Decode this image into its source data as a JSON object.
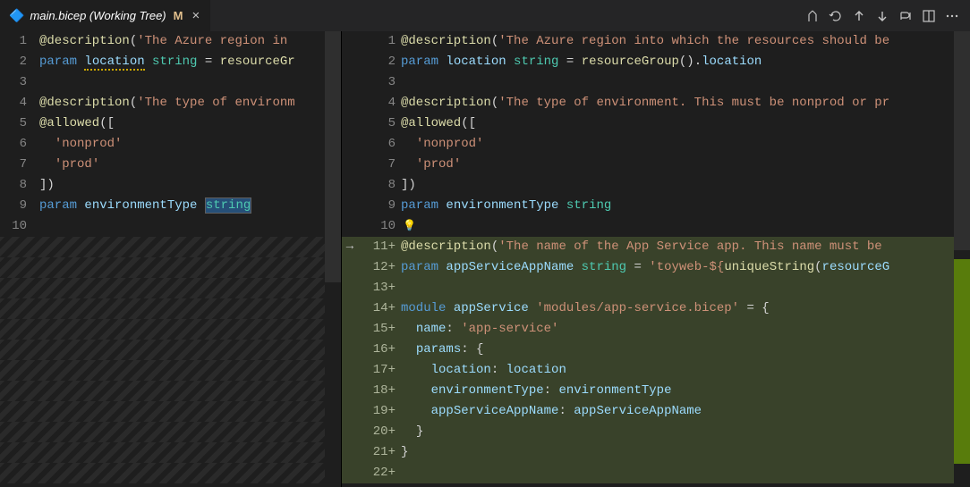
{
  "tab": {
    "icon": "🔷",
    "title": "main.bicep (Working Tree)",
    "modified_badge": "M",
    "close": "×"
  },
  "left": {
    "lines": [
      {
        "num": "1",
        "tokens": [
          [
            "decor",
            "@description"
          ],
          [
            "punc",
            "("
          ],
          [
            "str",
            "'The Azure region in"
          ]
        ]
      },
      {
        "num": "2",
        "tokens": [
          [
            "kw",
            "param "
          ],
          [
            "var_sq",
            "location"
          ],
          [
            "ident",
            " "
          ],
          [
            "type",
            "string"
          ],
          [
            "ident",
            " = "
          ],
          [
            "fn",
            "resourceGr"
          ]
        ]
      },
      {
        "num": "3",
        "tokens": []
      },
      {
        "num": "4",
        "tokens": [
          [
            "decor",
            "@description"
          ],
          [
            "punc",
            "("
          ],
          [
            "str",
            "'The type of environm"
          ]
        ]
      },
      {
        "num": "5",
        "tokens": [
          [
            "decor",
            "@allowed"
          ],
          [
            "punc",
            "(["
          ]
        ]
      },
      {
        "num": "6",
        "tokens": [
          [
            "ident",
            "  "
          ],
          [
            "str",
            "'nonprod'"
          ]
        ]
      },
      {
        "num": "7",
        "tokens": [
          [
            "ident",
            "  "
          ],
          [
            "str",
            "'prod'"
          ]
        ]
      },
      {
        "num": "8",
        "tokens": [
          [
            "punc",
            "])"
          ]
        ]
      },
      {
        "num": "9",
        "tokens": [
          [
            "kw",
            "param "
          ],
          [
            "var",
            "environmentType "
          ],
          [
            "type_sel",
            "string"
          ]
        ]
      },
      {
        "num": "10",
        "tokens": []
      },
      {
        "filler": true
      },
      {
        "filler": true
      },
      {
        "filler": true
      },
      {
        "filler": true
      },
      {
        "filler": true
      },
      {
        "filler": true
      },
      {
        "filler": true
      },
      {
        "filler": true
      },
      {
        "filler": true
      },
      {
        "filler": true
      },
      {
        "filler": true
      },
      {
        "filler": true
      }
    ]
  },
  "right": {
    "lines": [
      {
        "num": "1",
        "tokens": [
          [
            "decor",
            "@description"
          ],
          [
            "punc",
            "("
          ],
          [
            "str",
            "'The Azure region into which the resources should be"
          ]
        ]
      },
      {
        "num": "2",
        "tokens": [
          [
            "kw",
            "param "
          ],
          [
            "var",
            "location"
          ],
          [
            "ident",
            " "
          ],
          [
            "type",
            "string"
          ],
          [
            "ident",
            " = "
          ],
          [
            "fn",
            "resourceGroup"
          ],
          [
            "punc",
            "()."
          ],
          [
            "var",
            "location"
          ]
        ]
      },
      {
        "num": "3",
        "tokens": []
      },
      {
        "num": "4",
        "tokens": [
          [
            "decor",
            "@description"
          ],
          [
            "punc",
            "("
          ],
          [
            "str",
            "'The type of environment. This must be nonprod or pr"
          ]
        ]
      },
      {
        "num": "5",
        "tokens": [
          [
            "decor",
            "@allowed"
          ],
          [
            "punc",
            "(["
          ]
        ]
      },
      {
        "num": "6",
        "tokens": [
          [
            "ident",
            "  "
          ],
          [
            "str",
            "'nonprod'"
          ]
        ]
      },
      {
        "num": "7",
        "tokens": [
          [
            "ident",
            "  "
          ],
          [
            "str",
            "'prod'"
          ]
        ]
      },
      {
        "num": "8",
        "tokens": [
          [
            "punc",
            "])"
          ]
        ]
      },
      {
        "num": "9",
        "tokens": [
          [
            "kw",
            "param "
          ],
          [
            "var",
            "environmentType"
          ],
          [
            "ident",
            " "
          ],
          [
            "type",
            "string"
          ]
        ]
      },
      {
        "num": "10",
        "bulb": true,
        "tokens": []
      },
      {
        "num": "11+",
        "arrow": true,
        "added": true,
        "tokens": [
          [
            "decor",
            "@description"
          ],
          [
            "punc",
            "("
          ],
          [
            "str",
            "'The name of the App Service app. This name must be"
          ]
        ]
      },
      {
        "num": "12+",
        "added": true,
        "tokens": [
          [
            "kw",
            "param "
          ],
          [
            "var",
            "appServiceAppName"
          ],
          [
            "ident",
            " "
          ],
          [
            "type",
            "string"
          ],
          [
            "ident",
            " = "
          ],
          [
            "str",
            "'toyweb-${"
          ],
          [
            "fn",
            "uniqueString"
          ],
          [
            "punc",
            "("
          ],
          [
            "var",
            "resourceG"
          ]
        ]
      },
      {
        "num": "13+",
        "added": true,
        "tokens": []
      },
      {
        "num": "14+",
        "added": true,
        "tokens": [
          [
            "kw",
            "module "
          ],
          [
            "var",
            "appService"
          ],
          [
            "ident",
            " "
          ],
          [
            "str",
            "'modules/app-service.bicep'"
          ],
          [
            "ident",
            " = "
          ],
          [
            "punc",
            "{"
          ]
        ]
      },
      {
        "num": "15+",
        "added": true,
        "tokens": [
          [
            "ident",
            "  "
          ],
          [
            "var",
            "name"
          ],
          [
            "punc",
            ": "
          ],
          [
            "str",
            "'app-service'"
          ]
        ]
      },
      {
        "num": "16+",
        "added": true,
        "tokens": [
          [
            "ident",
            "  "
          ],
          [
            "var",
            "params"
          ],
          [
            "punc",
            ": {"
          ]
        ]
      },
      {
        "num": "17+",
        "added": true,
        "tokens": [
          [
            "ident",
            "    "
          ],
          [
            "var",
            "location"
          ],
          [
            "punc",
            ": "
          ],
          [
            "var",
            "location"
          ]
        ]
      },
      {
        "num": "18+",
        "added": true,
        "tokens": [
          [
            "ident",
            "    "
          ],
          [
            "var",
            "environmentType"
          ],
          [
            "punc",
            ": "
          ],
          [
            "var",
            "environmentType"
          ]
        ]
      },
      {
        "num": "19+",
        "added": true,
        "tokens": [
          [
            "ident",
            "    "
          ],
          [
            "var",
            "appServiceAppName"
          ],
          [
            "punc",
            ": "
          ],
          [
            "var",
            "appServiceAppName"
          ]
        ]
      },
      {
        "num": "20+",
        "added": true,
        "tokens": [
          [
            "ident",
            "  "
          ],
          [
            "punc",
            "}"
          ]
        ]
      },
      {
        "num": "21+",
        "added": true,
        "tokens": [
          [
            "punc",
            "}"
          ]
        ]
      },
      {
        "num": "22+",
        "added": true,
        "tokens": []
      }
    ]
  }
}
